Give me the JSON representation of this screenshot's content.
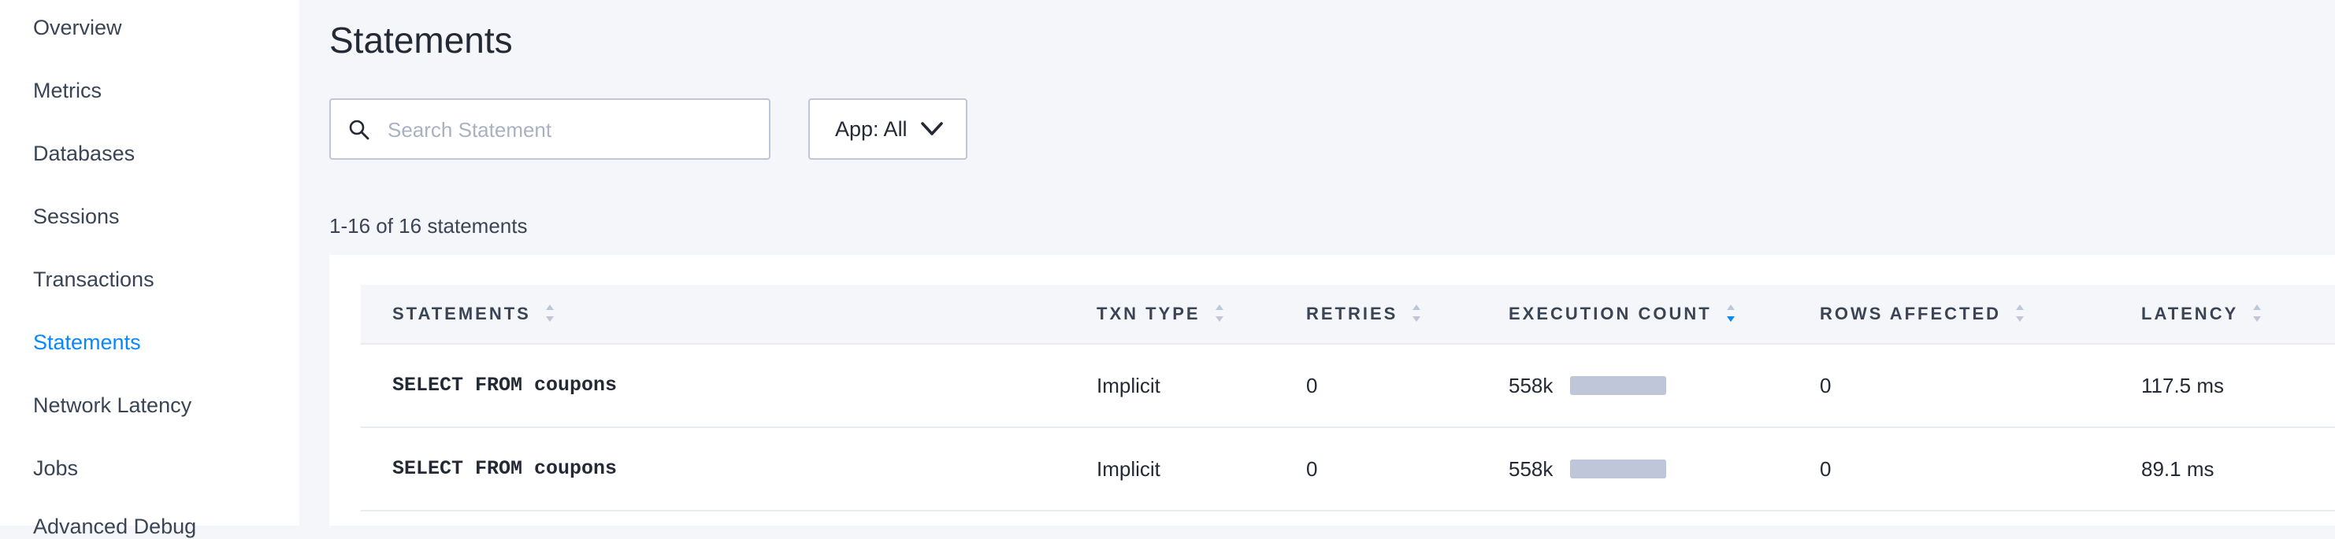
{
  "sidebar": {
    "items": [
      {
        "label": "Overview",
        "active": false
      },
      {
        "label": "Metrics",
        "active": false
      },
      {
        "label": "Databases",
        "active": false
      },
      {
        "label": "Sessions",
        "active": false
      },
      {
        "label": "Transactions",
        "active": false
      },
      {
        "label": "Statements",
        "active": true
      },
      {
        "label": "Network Latency",
        "active": false
      },
      {
        "label": "Jobs",
        "active": false
      },
      {
        "label": "Advanced Debug",
        "active": false
      }
    ]
  },
  "page": {
    "title": "Statements"
  },
  "search": {
    "placeholder": "Search Statement",
    "value": "",
    "icon": "search-icon"
  },
  "app_filter": {
    "label": "App: All",
    "icon": "chevron-down-icon"
  },
  "summary": {
    "text": "1-16 of 16 statements"
  },
  "table": {
    "columns": [
      {
        "label": "STATEMENTS",
        "sort": "none"
      },
      {
        "label": "TXN TYPE",
        "sort": "none"
      },
      {
        "label": "RETRIES",
        "sort": "none"
      },
      {
        "label": "EXECUTION COUNT",
        "sort": "descending"
      },
      {
        "label": "ROWS AFFECTED",
        "sort": "none"
      },
      {
        "label": "LATENCY",
        "sort": "none"
      }
    ],
    "rows": [
      {
        "statement": "SELECT FROM coupons",
        "txn_type": "Implicit",
        "retries": "0",
        "execution_count": "558k",
        "execution_bar_fraction": 1.0,
        "rows_affected": "0",
        "latency": "117.5 ms"
      },
      {
        "statement": "SELECT FROM coupons",
        "txn_type": "Implicit",
        "retries": "0",
        "execution_count": "558k",
        "execution_bar_fraction": 1.0,
        "rows_affected": "0",
        "latency": "89.1 ms"
      }
    ]
  },
  "colors": {
    "accent": "#0788ff",
    "text": "#242a35",
    "muted_text": "#394455",
    "border": "#c0c6d9",
    "bar": "#c0c6d9",
    "page_bg": "#f5f6fa"
  }
}
